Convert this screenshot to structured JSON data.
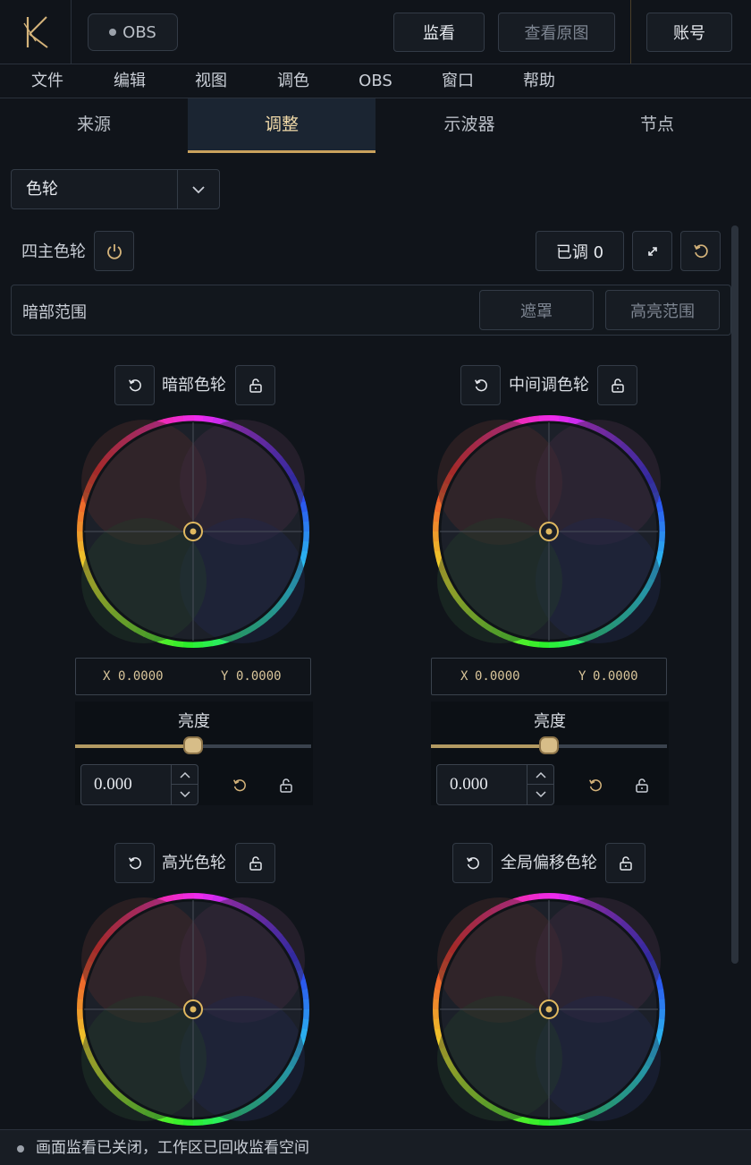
{
  "colors": {
    "accent": "#c9a15c",
    "background": "#10141a",
    "active_tab_bg": "#1b2532",
    "value_text": "#d9c59a"
  },
  "topbar": {
    "logo_icon": "logo-k-icon",
    "obs_label": "OBS",
    "monitor_label": "监看",
    "original_label": "查看原图",
    "account_label": "账号"
  },
  "menu": [
    "文件",
    "编辑",
    "视图",
    "调色",
    "OBS",
    "窗口",
    "帮助"
  ],
  "tabs": [
    {
      "label": "来源",
      "active": false
    },
    {
      "label": "调整",
      "active": true
    },
    {
      "label": "示波器",
      "active": false
    },
    {
      "label": "节点",
      "active": false
    }
  ],
  "panel": {
    "select_value": "色轮",
    "select_icon": "chevron-down-icon",
    "four_wheels_label": "四主色轮",
    "power_icon": "power-icon",
    "adjusted_label": "已调 0",
    "expand_icon": "expand-icon",
    "reset_icon": "reset-icon",
    "range_label": "暗部范围",
    "mask_label": "遮罩",
    "highlight_range_label": "高亮范围"
  },
  "wheels": [
    {
      "title": "暗部色轮",
      "x_label": "X",
      "x_value": "0.0000",
      "y_label": "Y",
      "y_value": "0.0000",
      "lum_label": "亮度",
      "lum_value": "0.000",
      "lum_level": 0.5
    },
    {
      "title": "中间调色轮",
      "x_label": "X",
      "x_value": "0.0000",
      "y_label": "Y",
      "y_value": "0.0000",
      "lum_label": "亮度",
      "lum_value": "0.000",
      "lum_level": 0.5
    },
    {
      "title": "高光色轮"
    },
    {
      "title": "全局偏移色轮"
    }
  ],
  "status": {
    "text": "画面监看已关闭，工作区已回收监看空间"
  }
}
